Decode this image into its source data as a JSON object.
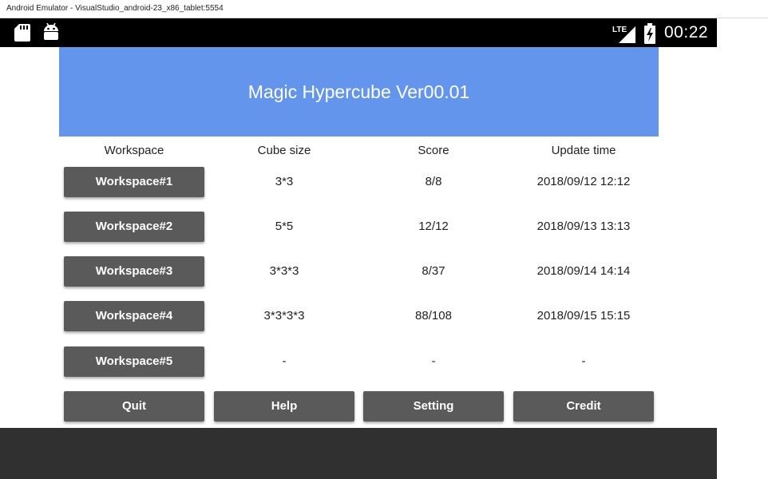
{
  "window": {
    "title": "Android Emulator - VisualStudio_android-23_x86_tablet:5554"
  },
  "status_bar": {
    "icons": [
      "sd-card-icon",
      "android-icon",
      "lte-signal-icon",
      "battery-charging-icon"
    ],
    "network_label": "LTE",
    "time": "00:22"
  },
  "app": {
    "title": "Magic Hypercube Ver00.01",
    "accent_color": "#6495ed",
    "button_color": "#5a5a5a"
  },
  "table": {
    "headers": [
      "Workspace",
      "Cube size",
      "Score",
      "Update time"
    ],
    "rows": [
      {
        "workspace": "Workspace#1",
        "cube_size": "3*3",
        "score": "8/8",
        "update_time": "2018/09/12 12:12"
      },
      {
        "workspace": "Workspace#2",
        "cube_size": "5*5",
        "score": "12/12",
        "update_time": "2018/09/13 13:13"
      },
      {
        "workspace": "Workspace#3",
        "cube_size": "3*3*3",
        "score": "8/37",
        "update_time": "2018/09/14 14:14"
      },
      {
        "workspace": "Workspace#4",
        "cube_size": "3*3*3*3",
        "score": "88/108",
        "update_time": "2018/09/15 15:15"
      },
      {
        "workspace": "Workspace#5",
        "cube_size": "-",
        "score": "-",
        "update_time": "-"
      }
    ]
  },
  "bottom_buttons": [
    "Quit",
    "Help",
    "Setting",
    "Credit"
  ]
}
